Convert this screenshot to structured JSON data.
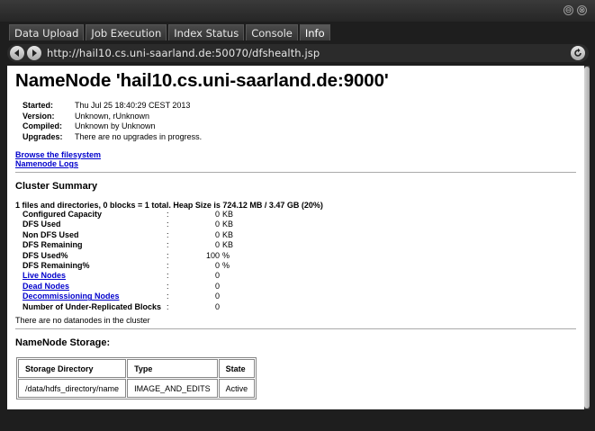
{
  "window": {
    "minimize_glyph": "⊖",
    "close_glyph": "⊗"
  },
  "tabs": [
    {
      "label": "Data Upload"
    },
    {
      "label": "Job Execution"
    },
    {
      "label": "Index Status"
    },
    {
      "label": "Console"
    },
    {
      "label": "Info"
    }
  ],
  "navbar": {
    "url": "http://hail10.cs.uni-saarland.de:50070/dfshealth.jsp"
  },
  "page": {
    "title": "NameNode 'hail10.cs.uni-saarland.de:9000'",
    "info": [
      {
        "label": "Started:",
        "value": "Thu Jul 25 18:40:29 CEST 2013"
      },
      {
        "label": "Version:",
        "value": "Unknown, rUnknown"
      },
      {
        "label": "Compiled:",
        "value": "Unknown by Unknown"
      },
      {
        "label": "Upgrades:",
        "value": "There are no upgrades in progress."
      }
    ],
    "links": [
      "Browse the filesystem",
      "Namenode Logs"
    ],
    "cluster_heading": "Cluster Summary",
    "summary_line": "1 files and directories, 0 blocks = 1 total. Heap Size is 724.12 MB / 3.47 GB (20%)",
    "stats": [
      {
        "label": "Configured Capacity",
        "value": "0",
        "unit": "KB",
        "link": false
      },
      {
        "label": "DFS Used",
        "value": "0",
        "unit": "KB",
        "link": false
      },
      {
        "label": "Non DFS Used",
        "value": "0",
        "unit": "KB",
        "link": false
      },
      {
        "label": "DFS Remaining",
        "value": "0",
        "unit": "KB",
        "link": false
      },
      {
        "label": "DFS Used%",
        "value": "100",
        "unit": "%",
        "link": false
      },
      {
        "label": "DFS Remaining%",
        "value": "0",
        "unit": "%",
        "link": false
      },
      {
        "label": "Live Nodes",
        "value": "0",
        "unit": "",
        "link": true
      },
      {
        "label": "Dead Nodes",
        "value": "0",
        "unit": "",
        "link": true
      },
      {
        "label": "Decommissioning Nodes",
        "value": "0",
        "unit": "",
        "link": true
      },
      {
        "label": "Number of Under-Replicated Blocks",
        "value": "0",
        "unit": "",
        "link": false
      }
    ],
    "no_datanodes_note": "There are no datanodes in the cluster",
    "storage_heading": "NameNode Storage:",
    "storage_table": {
      "headers": [
        "Storage Directory",
        "Type",
        "State"
      ],
      "rows": [
        [
          "/data/hdfs_directory/name",
          "IMAGE_AND_EDITS",
          "Active"
        ]
      ]
    }
  },
  "colors": {
    "link": "#0000cc",
    "chrome_bg": "#1e1e1e"
  }
}
